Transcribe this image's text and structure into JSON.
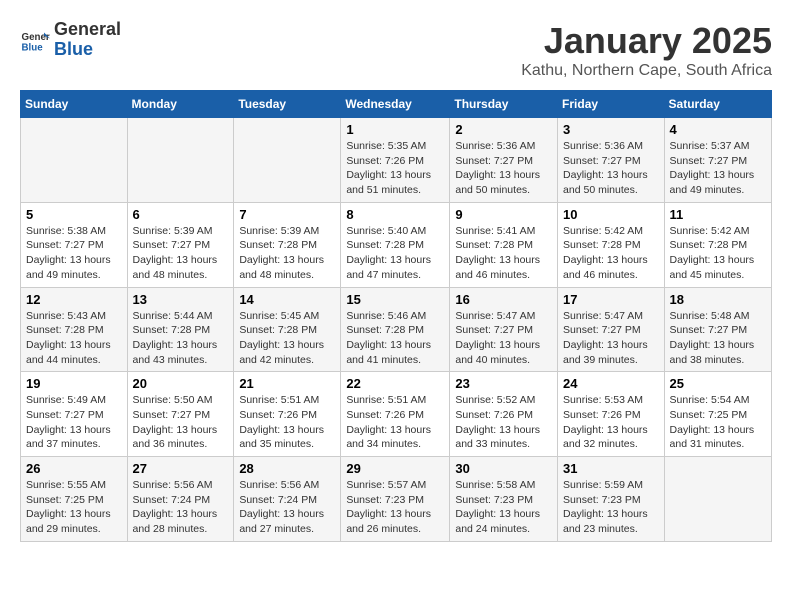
{
  "logo": {
    "line1": "General",
    "line2": "Blue"
  },
  "title": "January 2025",
  "subtitle": "Kathu, Northern Cape, South Africa",
  "weekdays": [
    "Sunday",
    "Monday",
    "Tuesday",
    "Wednesday",
    "Thursday",
    "Friday",
    "Saturday"
  ],
  "weeks": [
    [
      {
        "day": "",
        "info": ""
      },
      {
        "day": "",
        "info": ""
      },
      {
        "day": "",
        "info": ""
      },
      {
        "day": "1",
        "info": "Sunrise: 5:35 AM\nSunset: 7:26 PM\nDaylight: 13 hours\nand 51 minutes."
      },
      {
        "day": "2",
        "info": "Sunrise: 5:36 AM\nSunset: 7:27 PM\nDaylight: 13 hours\nand 50 minutes."
      },
      {
        "day": "3",
        "info": "Sunrise: 5:36 AM\nSunset: 7:27 PM\nDaylight: 13 hours\nand 50 minutes."
      },
      {
        "day": "4",
        "info": "Sunrise: 5:37 AM\nSunset: 7:27 PM\nDaylight: 13 hours\nand 49 minutes."
      }
    ],
    [
      {
        "day": "5",
        "info": "Sunrise: 5:38 AM\nSunset: 7:27 PM\nDaylight: 13 hours\nand 49 minutes."
      },
      {
        "day": "6",
        "info": "Sunrise: 5:39 AM\nSunset: 7:27 PM\nDaylight: 13 hours\nand 48 minutes."
      },
      {
        "day": "7",
        "info": "Sunrise: 5:39 AM\nSunset: 7:28 PM\nDaylight: 13 hours\nand 48 minutes."
      },
      {
        "day": "8",
        "info": "Sunrise: 5:40 AM\nSunset: 7:28 PM\nDaylight: 13 hours\nand 47 minutes."
      },
      {
        "day": "9",
        "info": "Sunrise: 5:41 AM\nSunset: 7:28 PM\nDaylight: 13 hours\nand 46 minutes."
      },
      {
        "day": "10",
        "info": "Sunrise: 5:42 AM\nSunset: 7:28 PM\nDaylight: 13 hours\nand 46 minutes."
      },
      {
        "day": "11",
        "info": "Sunrise: 5:42 AM\nSunset: 7:28 PM\nDaylight: 13 hours\nand 45 minutes."
      }
    ],
    [
      {
        "day": "12",
        "info": "Sunrise: 5:43 AM\nSunset: 7:28 PM\nDaylight: 13 hours\nand 44 minutes."
      },
      {
        "day": "13",
        "info": "Sunrise: 5:44 AM\nSunset: 7:28 PM\nDaylight: 13 hours\nand 43 minutes."
      },
      {
        "day": "14",
        "info": "Sunrise: 5:45 AM\nSunset: 7:28 PM\nDaylight: 13 hours\nand 42 minutes."
      },
      {
        "day": "15",
        "info": "Sunrise: 5:46 AM\nSunset: 7:28 PM\nDaylight: 13 hours\nand 41 minutes."
      },
      {
        "day": "16",
        "info": "Sunrise: 5:47 AM\nSunset: 7:27 PM\nDaylight: 13 hours\nand 40 minutes."
      },
      {
        "day": "17",
        "info": "Sunrise: 5:47 AM\nSunset: 7:27 PM\nDaylight: 13 hours\nand 39 minutes."
      },
      {
        "day": "18",
        "info": "Sunrise: 5:48 AM\nSunset: 7:27 PM\nDaylight: 13 hours\nand 38 minutes."
      }
    ],
    [
      {
        "day": "19",
        "info": "Sunrise: 5:49 AM\nSunset: 7:27 PM\nDaylight: 13 hours\nand 37 minutes."
      },
      {
        "day": "20",
        "info": "Sunrise: 5:50 AM\nSunset: 7:27 PM\nDaylight: 13 hours\nand 36 minutes."
      },
      {
        "day": "21",
        "info": "Sunrise: 5:51 AM\nSunset: 7:26 PM\nDaylight: 13 hours\nand 35 minutes."
      },
      {
        "day": "22",
        "info": "Sunrise: 5:51 AM\nSunset: 7:26 PM\nDaylight: 13 hours\nand 34 minutes."
      },
      {
        "day": "23",
        "info": "Sunrise: 5:52 AM\nSunset: 7:26 PM\nDaylight: 13 hours\nand 33 minutes."
      },
      {
        "day": "24",
        "info": "Sunrise: 5:53 AM\nSunset: 7:26 PM\nDaylight: 13 hours\nand 32 minutes."
      },
      {
        "day": "25",
        "info": "Sunrise: 5:54 AM\nSunset: 7:25 PM\nDaylight: 13 hours\nand 31 minutes."
      }
    ],
    [
      {
        "day": "26",
        "info": "Sunrise: 5:55 AM\nSunset: 7:25 PM\nDaylight: 13 hours\nand 29 minutes."
      },
      {
        "day": "27",
        "info": "Sunrise: 5:56 AM\nSunset: 7:24 PM\nDaylight: 13 hours\nand 28 minutes."
      },
      {
        "day": "28",
        "info": "Sunrise: 5:56 AM\nSunset: 7:24 PM\nDaylight: 13 hours\nand 27 minutes."
      },
      {
        "day": "29",
        "info": "Sunrise: 5:57 AM\nSunset: 7:23 PM\nDaylight: 13 hours\nand 26 minutes."
      },
      {
        "day": "30",
        "info": "Sunrise: 5:58 AM\nSunset: 7:23 PM\nDaylight: 13 hours\nand 24 minutes."
      },
      {
        "day": "31",
        "info": "Sunrise: 5:59 AM\nSunset: 7:23 PM\nDaylight: 13 hours\nand 23 minutes."
      },
      {
        "day": "",
        "info": ""
      }
    ]
  ]
}
